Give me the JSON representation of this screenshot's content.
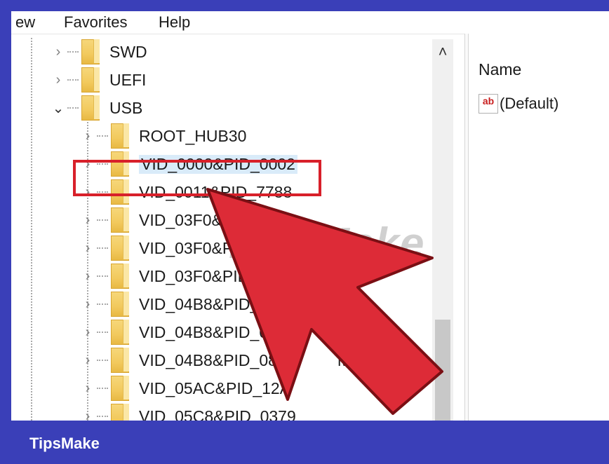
{
  "menubar": {
    "items": [
      "ew",
      "Favorites",
      "Help"
    ]
  },
  "tree": {
    "nodes": [
      {
        "label": "SWD",
        "expanded": false
      },
      {
        "label": "UEFI",
        "expanded": false
      },
      {
        "label": "USB",
        "expanded": true
      },
      {
        "label": "ROOT_HUB30",
        "expanded": false
      },
      {
        "label": "VID_0000&PID_0002",
        "expanded": false,
        "selected": true
      },
      {
        "label": "VID_0011&PID_7788",
        "expanded": false
      },
      {
        "label": "VID_03F0&",
        "expanded": false
      },
      {
        "label": "VID_03F0&P",
        "expanded": false
      },
      {
        "label": "VID_03F0&PID",
        "expanded": false
      },
      {
        "label": "VID_04B8&PID_",
        "expanded": false
      },
      {
        "label": "VID_04B8&PID_0",
        "expanded": false
      },
      {
        "label": "VID_04B8&PID_08",
        "suffix": "MI_01",
        "expanded": false
      },
      {
        "label": "VID_05AC&PID_12A",
        "expanded": false
      },
      {
        "label": "VID_05C8&PID_0379",
        "expanded": false
      }
    ]
  },
  "values_pane": {
    "column_name": "Name",
    "rows": [
      {
        "icon": "string-value-icon",
        "icon_text": "ab",
        "name": "(Default)"
      }
    ]
  },
  "watermark": "TipsMake",
  "footer": {
    "brand": "TipsMake"
  },
  "colors": {
    "accent": "#3a3fb8",
    "highlight_box": "#d8202a",
    "arrow": "#dd2b37",
    "selection": "#d9ebf9"
  },
  "icons": {
    "scroll_up": "chevron-up-icon",
    "collapsed": "chevron-right-icon",
    "expanded": "chevron-down-icon",
    "folder": "folder-icon"
  }
}
